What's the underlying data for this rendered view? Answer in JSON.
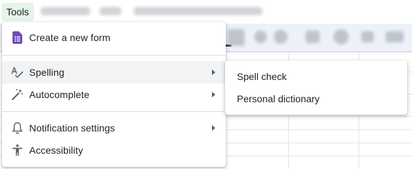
{
  "menubar": {
    "active_menu": "Tools"
  },
  "tools_menu": {
    "items": [
      {
        "label": "Create a new form",
        "icon": "forms-icon",
        "has_submenu": false
      },
      {
        "label": "Spelling",
        "icon": "spellcheck-icon",
        "has_submenu": true,
        "highlighted": true
      },
      {
        "label": "Autocomplete",
        "icon": "magic-wand-icon",
        "has_submenu": true
      },
      {
        "label": "Notification settings",
        "icon": "bell-icon",
        "has_submenu": true
      },
      {
        "label": "Accessibility",
        "icon": "accessibility-icon",
        "has_submenu": false
      }
    ]
  },
  "spelling_submenu": {
    "items": [
      {
        "label": "Spell check"
      },
      {
        "label": "Personal dictionary"
      }
    ]
  },
  "colors": {
    "forms_purple": "#7248b9",
    "menu_highlight": "#f1f3f4",
    "active_menu_bg": "#e6f4ea",
    "icon_gray": "#5f6368"
  }
}
